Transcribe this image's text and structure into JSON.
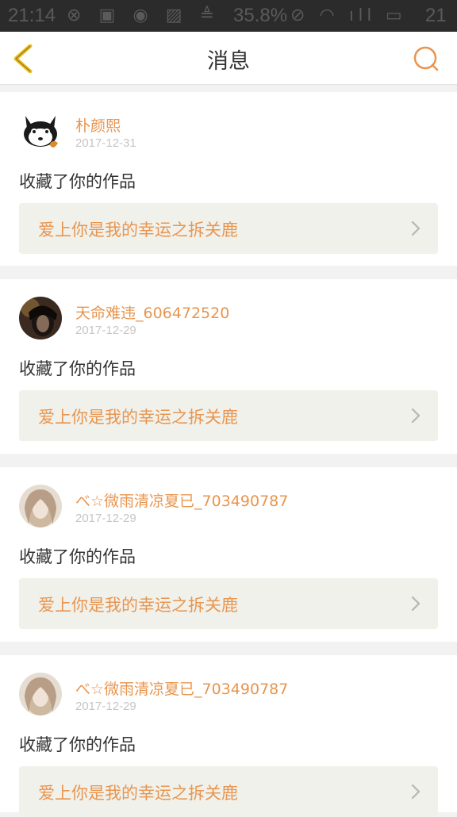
{
  "status_bar": {
    "time": "21:14",
    "battery": "35.8%",
    "time_right": "21"
  },
  "header": {
    "title": "消息",
    "back_icon": "chevron-left-icon",
    "search_icon": "search-icon"
  },
  "colors": {
    "accent": "#e8954f",
    "back_icon": "#f0c020",
    "work_bg": "#f1f1eb"
  },
  "messages": [
    {
      "username": "朴颜熙",
      "date": "2017-12-31",
      "action": "收藏了你的作品",
      "work_title": "爱上你是我的幸运之拆关鹿",
      "avatar": "cat-avatar"
    },
    {
      "username": "天命难违_606472520",
      "date": "2017-12-29",
      "action": "收藏了你的作品",
      "work_title": "爱上你是我的幸运之拆关鹿",
      "avatar": "dark-portrait-avatar"
    },
    {
      "username": "べ☆微雨清凉夏已_703490787",
      "date": "2017-12-29",
      "action": "收藏了你的作品",
      "work_title": "爱上你是我的幸运之拆关鹿",
      "avatar": "girl-portrait-avatar"
    },
    {
      "username": "べ☆微雨清凉夏已_703490787",
      "date": "2017-12-29",
      "action": "收藏了你的作品",
      "work_title": "爱上你是我的幸运之拆关鹿",
      "avatar": "girl-portrait-avatar"
    }
  ]
}
